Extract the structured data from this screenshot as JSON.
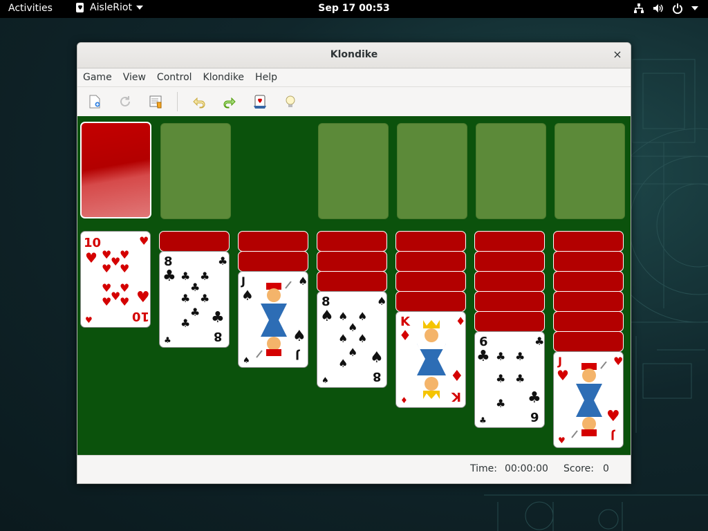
{
  "topbar": {
    "activities": "Activities",
    "app_name": "AisleRiot",
    "clock": "Sep 17  00:53"
  },
  "window": {
    "title": "Klondike",
    "close": "×"
  },
  "menu": [
    "Game",
    "View",
    "Control",
    "Klondike",
    "Help"
  ],
  "toolbar": {
    "icons": [
      "new-game-icon",
      "restart-icon",
      "select-game-icon",
      "undo-icon",
      "redo-icon",
      "deal-icon",
      "hint-icon"
    ]
  },
  "tableau_cards": {
    "c1": {
      "rank": "10",
      "suit": "♥",
      "color": "#d40000"
    },
    "c2": {
      "rank": "8",
      "suit": "♣",
      "color": "#111111"
    },
    "c3": {
      "rank": "J",
      "suit": "♠",
      "color": "#111111"
    },
    "c4": {
      "rank": "8",
      "suit": "♠",
      "color": "#111111"
    },
    "c5": {
      "rank": "K",
      "suit": "♦",
      "color": "#d40000"
    },
    "c6": {
      "rank": "6",
      "suit": "♣",
      "color": "#111111"
    },
    "c7": {
      "rank": "J",
      "suit": "♥",
      "color": "#d40000"
    }
  },
  "status": {
    "time_label": "Time:",
    "time": "00:00:00",
    "score_label": "Score:",
    "score": "0"
  },
  "colors": {
    "felt": "#0b520c",
    "slot": "#5c8a39",
    "card_back": "#b30000"
  }
}
